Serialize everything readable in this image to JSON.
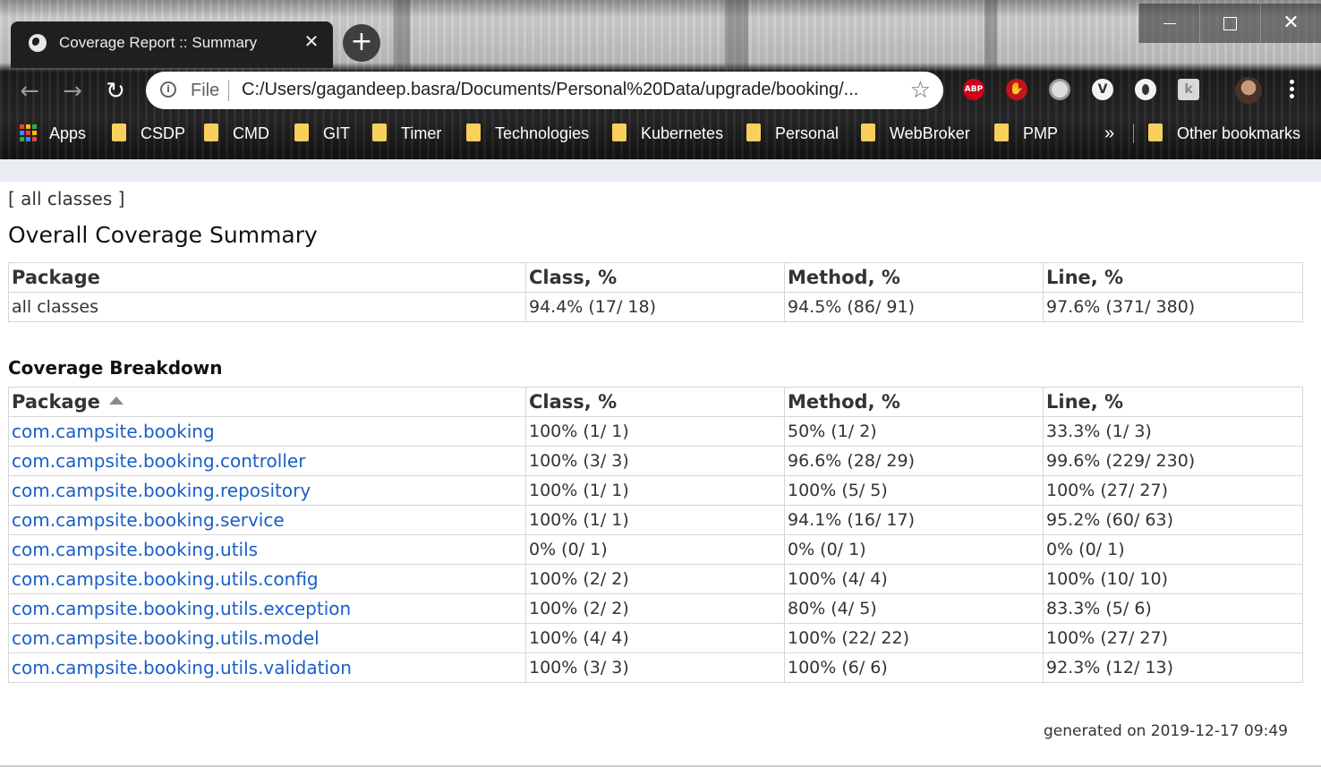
{
  "browser": {
    "tab_title": "Coverage Report :: Summary",
    "tab_close": "✕",
    "new_tab": "+",
    "address_label": "File",
    "url": "C:/Users/gagandeep.basra/Documents/Personal%20Data/upgrade/booking/...",
    "bookmarks": [
      "Apps",
      "CSDP",
      "CMD",
      "GIT",
      "Timer",
      "Technologies",
      "Kubernetes",
      "Personal",
      "WebBroker",
      "PMP"
    ],
    "more_bookmarks": "»",
    "other_bookmarks": "Other bookmarks",
    "extensions": [
      "ABP",
      "✋",
      "",
      "V",
      "",
      "k"
    ]
  },
  "page": {
    "nav_link": "all classes",
    "overall_title": "Overall Coverage Summary",
    "summary_headers": [
      "Package",
      "Class, %",
      "Method, %",
      "Line, %"
    ],
    "summary_row": [
      "all classes",
      "94.4% (17/ 18)",
      "94.5% (86/ 91)",
      "97.6% (371/ 380)"
    ],
    "breakdown_title": "Coverage Breakdown",
    "breakdown_headers": [
      "Package",
      "Class, %",
      "Method, %",
      "Line, %"
    ],
    "breakdown_rows": [
      [
        "com.campsite.booking",
        "100% (1/ 1)",
        "50% (1/ 2)",
        "33.3% (1/ 3)"
      ],
      [
        "com.campsite.booking.controller",
        "100% (3/ 3)",
        "96.6% (28/ 29)",
        "99.6% (229/ 230)"
      ],
      [
        "com.campsite.booking.repository",
        "100% (1/ 1)",
        "100% (5/ 5)",
        "100% (27/ 27)"
      ],
      [
        "com.campsite.booking.service",
        "100% (1/ 1)",
        "94.1% (16/ 17)",
        "95.2% (60/ 63)"
      ],
      [
        "com.campsite.booking.utils",
        "0% (0/ 1)",
        "0% (0/ 1)",
        "0% (0/ 1)"
      ],
      [
        "com.campsite.booking.utils.config",
        "100% (2/ 2)",
        "100% (4/ 4)",
        "100% (10/ 10)"
      ],
      [
        "com.campsite.booking.utils.exception",
        "100% (2/ 2)",
        "80% (4/ 5)",
        "83.3% (5/ 6)"
      ],
      [
        "com.campsite.booking.utils.model",
        "100% (4/ 4)",
        "100% (22/ 22)",
        "100% (27/ 27)"
      ],
      [
        "com.campsite.booking.utils.validation",
        "100% (3/ 3)",
        "100% (6/ 6)",
        "92.3% (12/ 13)"
      ]
    ],
    "generated": "generated on 2019-12-17 09:49"
  },
  "colors": {
    "link": "#1a5fc7",
    "folder": "#f9d05b",
    "page_strip": "#e8edf2"
  }
}
